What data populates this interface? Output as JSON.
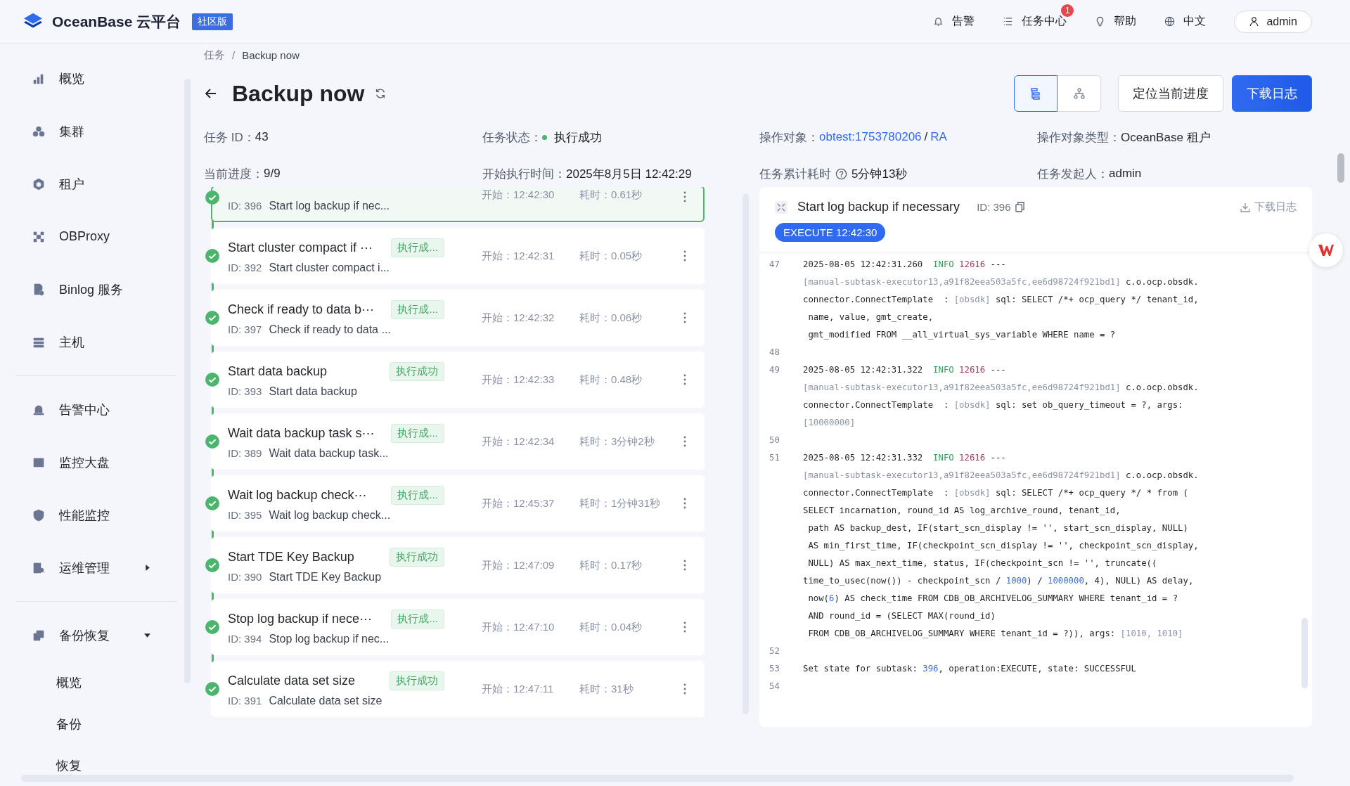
{
  "header": {
    "brand": "OceanBase 云平台",
    "edition": "社区版",
    "nav": [
      {
        "label": "告警"
      },
      {
        "label": "任务中心",
        "badge": "1"
      },
      {
        "label": "帮助"
      },
      {
        "label": "中文"
      }
    ],
    "user": "admin"
  },
  "sidebar": {
    "groups": [
      [
        {
          "label": "概览"
        },
        {
          "label": "集群"
        },
        {
          "label": "租户"
        },
        {
          "label": "OBProxy"
        },
        {
          "label": "Binlog 服务"
        },
        {
          "label": "主机"
        }
      ],
      [
        {
          "label": "告警中心"
        },
        {
          "label": "监控大盘"
        },
        {
          "label": "性能监控"
        },
        {
          "label": "运维管理",
          "expanded": false
        }
      ],
      [
        {
          "label": "备份恢复",
          "expanded": true,
          "children": [
            {
              "label": "概览"
            },
            {
              "label": "备份"
            },
            {
              "label": "恢复"
            }
          ]
        }
      ]
    ]
  },
  "breadcrumb": {
    "items": [
      "任务",
      "Backup now"
    ],
    "separator": "/"
  },
  "page_title": "Backup now",
  "view_toggle": [
    {
      "selected": true
    },
    {
      "selected": false
    }
  ],
  "actions": [
    {
      "label": "定位当前进度",
      "primary": false
    },
    {
      "label": "下载日志",
      "primary": true
    }
  ],
  "info_rows": [
    [
      {
        "kind": "text",
        "label": "任务 ID：",
        "value": "43"
      },
      {
        "kind": "status",
        "label": "任务状态：",
        "value": "执行成功",
        "color": "#4cb56d"
      },
      {
        "kind": "links",
        "label": "操作对象：",
        "links": [
          "obtest:1753780206",
          "RA"
        ],
        "separator": "/"
      },
      {
        "kind": "text",
        "label": "操作对象类型：",
        "value": "OceanBase 租户"
      }
    ],
    [
      {
        "kind": "text",
        "label": "当前进度：",
        "value": "9/9"
      },
      {
        "kind": "text",
        "label": "开始执行时间：",
        "value": "2025年8月5日 12:42:29"
      },
      {
        "kind": "help",
        "label": "任务累计耗时",
        "value": "5分钟13秒"
      },
      {
        "kind": "text",
        "label": "任务发起人：",
        "value": "admin"
      }
    ]
  ],
  "tasks": [
    {
      "id": "ID: 396",
      "description": "Start log backup if nec...",
      "start": "开始：12:42:30",
      "duration": "耗时：0.61秒",
      "selected": true
    },
    {
      "title": "Start cluster compact if ···",
      "badge": "执行成...",
      "id": "ID: 392",
      "description": "Start cluster compact i...",
      "start": "开始：12:42:31",
      "duration": "耗时：0.05秒",
      "selected": false
    },
    {
      "title": "Check if ready to data b···",
      "badge": "执行成...",
      "id": "ID: 397",
      "description": "Check if ready to data ...",
      "start": "开始：12:42:32",
      "duration": "耗时：0.06秒",
      "selected": false
    },
    {
      "title": "Start data backup",
      "badge": "执行成功",
      "id": "ID: 393",
      "description": "Start data backup",
      "start": "开始：12:42:33",
      "duration": "耗时：0.48秒",
      "selected": false
    },
    {
      "title": "Wait data backup task s···",
      "badge": "执行成...",
      "id": "ID: 389",
      "description": "Wait data backup task...",
      "start": "开始：12:42:34",
      "duration": "耗时：3分钟2秒",
      "selected": false
    },
    {
      "title": "Wait log backup check···",
      "badge": "执行成...",
      "id": "ID: 395",
      "description": "Wait log backup check...",
      "start": "开始：12:45:37",
      "duration": "耗时：1分钟31秒",
      "selected": false
    },
    {
      "title": "Start TDE Key Backup",
      "badge": "执行成功",
      "id": "ID: 390",
      "description": "Start TDE Key Backup",
      "start": "开始：12:47:09",
      "duration": "耗时：0.17秒",
      "selected": false
    },
    {
      "title": "Stop log backup if nece···",
      "badge": "执行成...",
      "id": "ID: 394",
      "description": "Stop log backup if nec...",
      "start": "开始：12:47:10",
      "duration": "耗时：0.04秒",
      "selected": false
    },
    {
      "title": "Calculate data set size",
      "badge": "执行成功",
      "id": "ID: 391",
      "description": "Calculate data set size",
      "start": "开始：12:47:11",
      "duration": "耗时：31秒",
      "selected": false
    }
  ],
  "log_panel": {
    "title": "Start log backup if necessary",
    "id": "ID: 396",
    "download": "下载日志",
    "tag": "EXECUTE 12:42:30",
    "lines": [
      {
        "number": "47",
        "rows": [
          {
            "parts": [
              {
                "kind": "text",
                "text": "2025-08-05 12:42:31.260  "
              },
              {
                "kind": "info",
                "text": "INFO"
              },
              {
                "kind": "pid",
                "text": " 12616"
              },
              {
                "kind": "text",
                "text": " ---"
              }
            ]
          },
          {
            "parts": [
              {
                "kind": "muted",
                "text": "[manual-subtask-executor13,a91f82eea503a5fc,ee6d98724f921bd1]"
              },
              {
                "kind": "text",
                "text": " c.o.ocp.obsdk."
              }
            ]
          },
          {
            "parts": [
              {
                "kind": "text",
                "text": "connector.ConnectTemplate  : "
              },
              {
                "kind": "muted",
                "text": "[obsdk]"
              },
              {
                "kind": "text",
                "text": " sql: SELECT /*+ ocp_query */ tenant_id,"
              }
            ]
          },
          {
            "parts": [
              {
                "kind": "text",
                "text": " name, value, gmt_create,"
              }
            ]
          },
          {
            "parts": [
              {
                "kind": "text",
                "text": " gmt_modified FROM __all_virtual_sys_variable WHERE name = ?"
              }
            ]
          }
        ]
      },
      {
        "number": "48"
      },
      {
        "number": "49",
        "rows": [
          {
            "parts": [
              {
                "kind": "text",
                "text": "2025-08-05 12:42:31.322  "
              },
              {
                "kind": "info",
                "text": "INFO"
              },
              {
                "kind": "pid",
                "text": " 12616"
              },
              {
                "kind": "text",
                "text": " ---"
              }
            ]
          },
          {
            "parts": [
              {
                "kind": "muted",
                "text": "[manual-subtask-executor13,a91f82eea503a5fc,ee6d98724f921bd1]"
              },
              {
                "kind": "text",
                "text": " c.o.ocp.obsdk."
              }
            ]
          },
          {
            "parts": [
              {
                "kind": "text",
                "text": "connector.ConnectTemplate  : "
              },
              {
                "kind": "muted",
                "text": "[obsdk]"
              },
              {
                "kind": "text",
                "text": " sql: set ob_query_timeout = ?, args:"
              }
            ]
          },
          {
            "parts": [
              {
                "kind": "muted",
                "text": "[10000000]"
              }
            ]
          }
        ]
      },
      {
        "number": "50"
      },
      {
        "number": "51",
        "rows": [
          {
            "parts": [
              {
                "kind": "text",
                "text": "2025-08-05 12:42:31.332  "
              },
              {
                "kind": "info",
                "text": "INFO"
              },
              {
                "kind": "pid",
                "text": " 12616"
              },
              {
                "kind": "text",
                "text": " ---"
              }
            ]
          },
          {
            "parts": [
              {
                "kind": "muted",
                "text": "[manual-subtask-executor13,a91f82eea503a5fc,ee6d98724f921bd1]"
              },
              {
                "kind": "text",
                "text": " c.o.ocp.obsdk."
              }
            ]
          },
          {
            "parts": [
              {
                "kind": "text",
                "text": "connector.ConnectTemplate  : "
              },
              {
                "kind": "muted",
                "text": "[obsdk]"
              },
              {
                "kind": "text",
                "text": " sql: SELECT /*+ ocp_query */ * from ("
              }
            ]
          },
          {
            "parts": [
              {
                "kind": "text",
                "text": "SELECT incarnation, round_id AS log_archive_round, tenant_id,"
              }
            ]
          },
          {
            "parts": [
              {
                "kind": "text",
                "text": " path AS backup_dest, IF(start_scn_display != '', start_scn_display, NULL)"
              }
            ]
          },
          {
            "parts": [
              {
                "kind": "text",
                "text": " AS min_first_time, IF(checkpoint_scn_display != '', checkpoint_scn_display,"
              }
            ]
          },
          {
            "parts": [
              {
                "kind": "text",
                "text": " NULL) AS max_next_time, status, IF(checkpoint_scn != '', truncate(("
              }
            ]
          },
          {
            "parts": [
              {
                "kind": "text",
                "text": "time_to_usec(now()) - checkpoint_scn / "
              },
              {
                "kind": "number",
                "text": "1000"
              },
              {
                "kind": "text",
                "text": ") / "
              },
              {
                "kind": "number",
                "text": "1000000"
              },
              {
                "kind": "text",
                "text": ", 4), NULL) AS delay,"
              }
            ]
          },
          {
            "parts": [
              {
                "kind": "text",
                "text": " now("
              },
              {
                "kind": "number",
                "text": "6"
              },
              {
                "kind": "text",
                "text": ") AS check_time FROM CDB_OB_ARCHIVELOG_SUMMARY WHERE tenant_id = ?"
              }
            ]
          },
          {
            "parts": [
              {
                "kind": "text",
                "text": " AND round_id = (SELECT MAX(round_id)"
              }
            ]
          },
          {
            "parts": [
              {
                "kind": "text",
                "text": " FROM CDB_OB_ARCHIVELOG_SUMMARY WHERE tenant_id = ?)), args: "
              },
              {
                "kind": "muted",
                "text": "[1010, 1010]"
              }
            ]
          }
        ]
      },
      {
        "number": "52"
      },
      {
        "number": "53",
        "rows": [
          {
            "parts": [
              {
                "kind": "text",
                "text": "Set state for subtask: "
              },
              {
                "kind": "number",
                "text": "396"
              },
              {
                "kind": "text",
                "text": ", operation:EXECUTE, state: SUCCESSFUL"
              }
            ]
          }
        ]
      },
      {
        "number": "54"
      }
    ]
  }
}
